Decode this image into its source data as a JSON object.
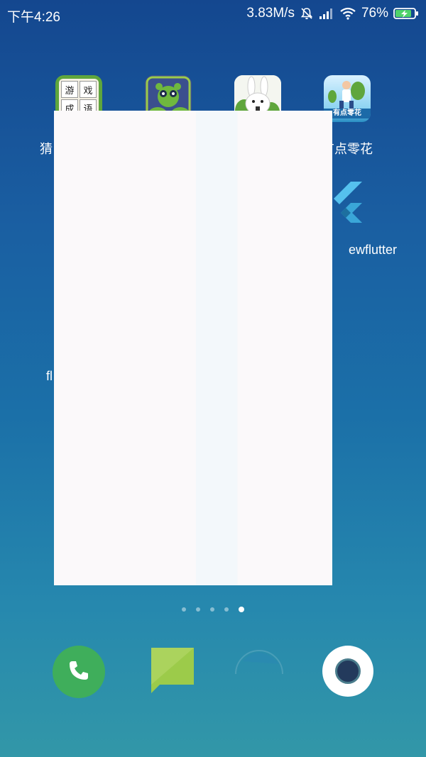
{
  "status_bar": {
    "time": "下午4:26",
    "network_speed": "3.83M/s",
    "battery_percent": "76%",
    "icons": [
      "mute-icon",
      "signal-icon",
      "wifi-icon",
      "battery-charging-icon"
    ]
  },
  "apps": [
    {
      "id": "idiom",
      "label": "猜",
      "icon": "idiom-game-icon",
      "tiles": [
        "游",
        "戏",
        "成",
        "语"
      ]
    },
    {
      "id": "panda",
      "label": "",
      "icon": "panda-icon"
    },
    {
      "id": "rabbit",
      "label": "",
      "icon": "rabbit-icon"
    },
    {
      "id": "money",
      "label": "有点零花",
      "icon": "money-app-icon",
      "icon_text": "有点零花"
    },
    {
      "id": "newflutter",
      "label": "ewflutter",
      "icon": "flutter-icon"
    },
    {
      "id": "fl",
      "label": "fl",
      "icon": ""
    }
  ],
  "overlay": {
    "colors": {
      "main": "#fbf9fa",
      "stripe": "#f3f8fb"
    }
  },
  "pager": {
    "pages": 5,
    "active": 5
  },
  "dock": [
    {
      "id": "phone",
      "icon": "phone-icon"
    },
    {
      "id": "messages",
      "icon": "message-icon"
    },
    {
      "id": "browser",
      "icon": "browser-icon"
    },
    {
      "id": "camera",
      "icon": "camera-icon"
    }
  ],
  "colors": {
    "wallpaper_top": "#14478f",
    "wallpaper_bottom": "#3297a8",
    "phone_green": "#3fae5b",
    "message_green": "#9ccb4a"
  }
}
